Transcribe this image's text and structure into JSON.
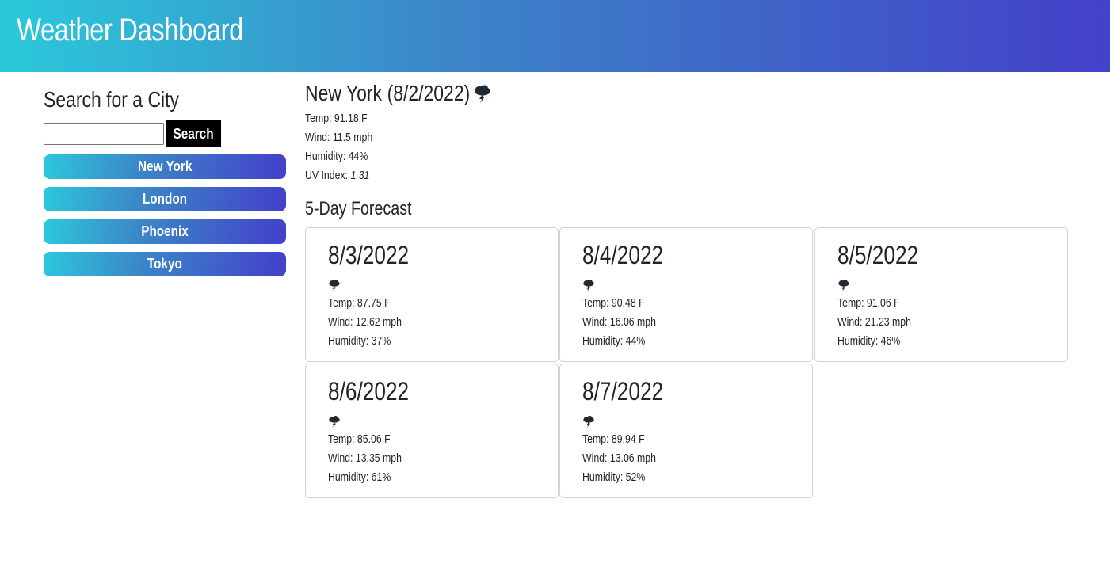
{
  "header": {
    "title": "Weather Dashboard"
  },
  "sidebar": {
    "heading": "Search for a City",
    "search": {
      "value": "",
      "placeholder": "",
      "button_label": "Search"
    },
    "cities": [
      "New York",
      "London",
      "Phoenix",
      "Tokyo"
    ]
  },
  "current": {
    "city": "New York",
    "date": "(8/2/2022)",
    "icon": "thunderstorm-icon",
    "temp": "Temp: 91.18 F",
    "wind": "Wind: 11.5 mph",
    "humidity": "Humidity: 44%",
    "uv_label": "UV Index:",
    "uv_value": "1.31"
  },
  "forecast": {
    "heading": "5-Day Forecast",
    "days": [
      {
        "date": "8/3/2022",
        "icon": "thunderstorm-icon",
        "temp": "Temp: 87.75 F",
        "wind": "Wind: 12.62 mph",
        "humidity": "Humidity: 37%"
      },
      {
        "date": "8/4/2022",
        "icon": "thunderstorm-icon",
        "temp": "Temp: 90.48 F",
        "wind": "Wind: 16.06 mph",
        "humidity": "Humidity: 44%"
      },
      {
        "date": "8/5/2022",
        "icon": "thunderstorm-icon",
        "temp": "Temp: 91.06 F",
        "wind": "Wind: 21.23 mph",
        "humidity": "Humidity: 46%"
      },
      {
        "date": "8/6/2022",
        "icon": "thunderstorm-icon",
        "temp": "Temp: 85.06 F",
        "wind": "Wind: 13.35 mph",
        "humidity": "Humidity: 61%"
      },
      {
        "date": "8/7/2022",
        "icon": "thunderstorm-icon",
        "temp": "Temp: 89.94 F",
        "wind": "Wind: 13.06 mph",
        "humidity": "Humidity: 52%"
      }
    ]
  },
  "colors": {
    "gradient_start": "#2bc9db",
    "gradient_mid": "#3c86c8",
    "gradient_end": "#4340c9",
    "search_button": "#000000"
  }
}
